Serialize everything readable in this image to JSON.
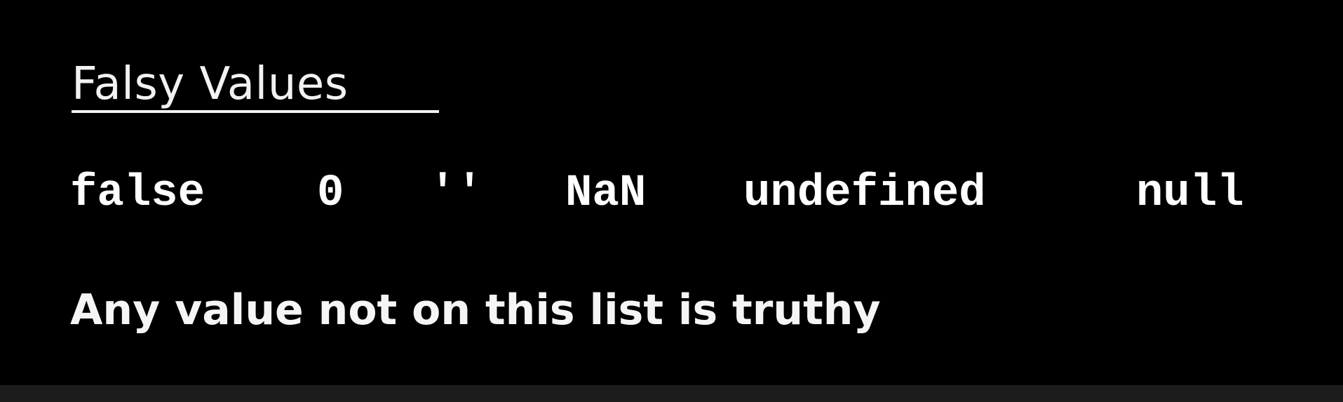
{
  "slide": {
    "title": "Falsy Values",
    "values": [
      "false",
      "0",
      "''",
      "NaN",
      "undefined",
      "null"
    ],
    "footer": "Any value not on this list is truthy"
  },
  "colors": {
    "background": "#000000",
    "text": "#ffffff",
    "bottom_bar": "#1c1c1c"
  }
}
